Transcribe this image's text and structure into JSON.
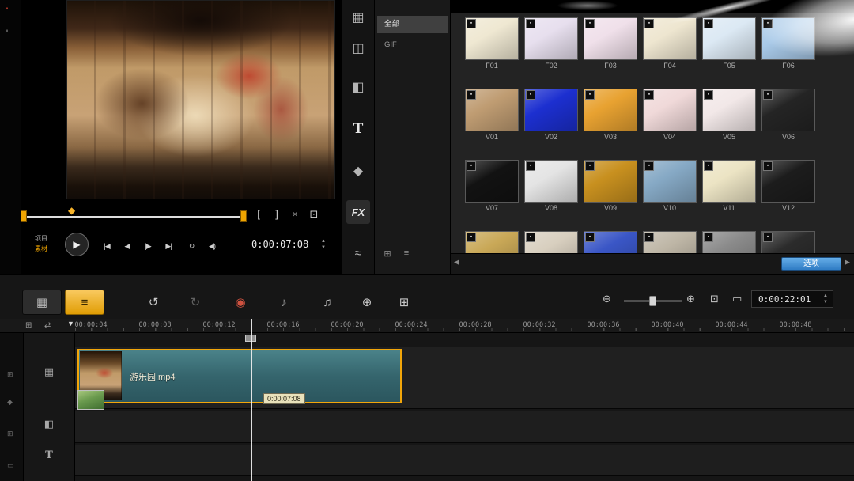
{
  "colors": {
    "accent": "#f2a60a",
    "selection_border": "#f0a500",
    "clip_fill": "#35656d",
    "options_button_blue": "#2f7cc4"
  },
  "icons": {
    "up": "▲",
    "down": "▼"
  },
  "left_strip": [
    {
      "name": "app-icon",
      "glyph": "▪",
      "color": "#a23226"
    },
    {
      "name": "panel-icon",
      "glyph": "▪",
      "color": "#555555"
    }
  ],
  "preview": {
    "mode_labels": [
      "项目",
      "素材"
    ],
    "timecode": "0:00:07:08",
    "transport": [
      {
        "name": "play",
        "glyph": "▶"
      },
      {
        "name": "home",
        "glyph": "|◀"
      },
      {
        "name": "prev-frame",
        "glyph": "◀|"
      },
      {
        "name": "next-frame",
        "glyph": "|▶"
      },
      {
        "name": "end",
        "glyph": "▶|"
      },
      {
        "name": "repeat",
        "glyph": "↻"
      },
      {
        "name": "volume",
        "glyph": "◀)"
      }
    ],
    "trim_icons": [
      {
        "name": "mark-in",
        "glyph": "["
      },
      {
        "name": "mark-out",
        "glyph": "]"
      },
      {
        "name": "split-clip",
        "glyph": "×"
      },
      {
        "name": "enlarge-preview",
        "glyph": "⊡"
      }
    ]
  },
  "nav_strip": [
    {
      "name": "media",
      "glyph": "▦"
    },
    {
      "name": "transition",
      "glyph": "◫"
    },
    {
      "name": "overlay",
      "glyph": "◧"
    },
    {
      "name": "title",
      "glyph": "T"
    },
    {
      "name": "graphic",
      "glyph": "◆"
    },
    {
      "name": "filter",
      "glyph": "FX",
      "active": true
    },
    {
      "name": "motion-path",
      "glyph": "≈"
    }
  ],
  "library": {
    "categories": [
      {
        "label": "全部",
        "selected": true
      },
      {
        "label": "GIF",
        "selected": false
      }
    ],
    "footer_icons": [
      {
        "name": "add-folder",
        "glyph": "⊞"
      },
      {
        "name": "list-view",
        "glyph": "≡"
      }
    ],
    "options_button": "选项",
    "scroll_left": "◀",
    "scroll_right": "▶",
    "badge_glyph": "▪",
    "rows": [
      {
        "items": [
          {
            "label": "F01",
            "tone": "#efe8d2"
          },
          {
            "label": "F02",
            "tone": "#e7dfee"
          },
          {
            "label": "F03",
            "tone": "#f0e0ea"
          },
          {
            "label": "F04",
            "tone": "#eee6d0"
          },
          {
            "label": "F05",
            "tone": "#dce9f4"
          },
          {
            "label": "F06",
            "tone": "#a8c9e8"
          }
        ]
      },
      {
        "items": [
          {
            "label": "V01",
            "tone": "#bf9c72"
          },
          {
            "label": "V02",
            "tone": "#1c2fd0"
          },
          {
            "label": "V03",
            "tone": "#e8a231"
          },
          {
            "label": "V04",
            "tone": "#f0d9d9"
          },
          {
            "label": "V05",
            "tone": "#f2e8e8"
          },
          {
            "label": "V06",
            "tone": "#242424"
          }
        ]
      },
      {
        "items": [
          {
            "label": "V07",
            "tone": "#121212"
          },
          {
            "label": "V08",
            "tone": "#e4e4e4"
          },
          {
            "label": "V09",
            "tone": "#c8901f"
          },
          {
            "label": "V10",
            "tone": "#86a9c5"
          },
          {
            "label": "V11",
            "tone": "#ece4c4"
          },
          {
            "label": "V12",
            "tone": "#1c1c1c"
          }
        ]
      },
      {
        "items": [
          {
            "label": "",
            "tone": "#c9a857"
          },
          {
            "label": "",
            "tone": "#d8cfbf"
          },
          {
            "label": "",
            "tone": "#3a56c6"
          },
          {
            "label": "",
            "tone": "#beb6a6"
          },
          {
            "label": "",
            "tone": "#8a8a8a"
          },
          {
            "label": "",
            "tone": "#2b2b2b"
          }
        ]
      }
    ]
  },
  "timeline": {
    "view_buttons": [
      {
        "name": "storyboard-view",
        "glyph": "▦",
        "active": false
      },
      {
        "name": "timeline-view",
        "glyph": "≡",
        "active": true
      }
    ],
    "tools": [
      {
        "name": "undo",
        "glyph": "↺"
      },
      {
        "name": "redo",
        "glyph": "↻",
        "dim": true
      },
      {
        "name": "record-capture",
        "glyph": "◉",
        "color": "#cf5240"
      },
      {
        "name": "sound-mixer",
        "glyph": "♪"
      },
      {
        "name": "auto-music",
        "glyph": "♫"
      },
      {
        "name": "motion-track",
        "glyph": "⊕"
      },
      {
        "name": "batch-convert",
        "glyph": "⊞"
      }
    ],
    "zoom": {
      "out": "⊖",
      "in": "⊕",
      "fit": "⊡",
      "project_fit": "▭",
      "timecode": "0:00:22:01"
    },
    "ruler_labels": [
      "00:00:04",
      "00:00:08",
      "00:00:12",
      "00:00:16",
      "00:00:20",
      "00:00:24",
      "00:00:28",
      "00:00:32",
      "00:00:36",
      "00:00:40",
      "00:00:44",
      "00:00:48"
    ],
    "marker_glyph": "▼",
    "header_icons": [
      {
        "name": "track-manager",
        "glyph": "⊞"
      },
      {
        "name": "ripple-edit",
        "glyph": "⇄"
      }
    ],
    "track_headers": [
      {
        "name": "video-track",
        "glyph": "▦"
      },
      {
        "name": "overlay-track",
        "glyph": "◧"
      },
      {
        "name": "title-track",
        "glyph": "T"
      }
    ],
    "rail_icons": [
      {
        "glyph": "⊞"
      },
      {
        "glyph": "◆"
      },
      {
        "glyph": "⊞"
      },
      {
        "glyph": "▭"
      }
    ],
    "clip": {
      "name": "游乐园.mp4",
      "tooltip": "0:00:07:08"
    }
  }
}
